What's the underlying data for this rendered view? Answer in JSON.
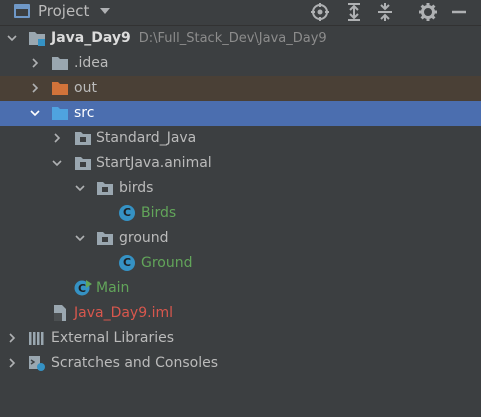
{
  "toolbar": {
    "title": "Project",
    "icons": [
      "project-panel-icon",
      "dropdown-icon",
      "locate-icon",
      "expand-all-icon",
      "collapse-all-icon",
      "settings-icon",
      "hide-icon"
    ]
  },
  "tree": {
    "root": {
      "name": "Java_Day9",
      "path": "D:\\Full_Stack_Dev\\Java_Day9"
    },
    "idea": ".idea",
    "out": "out",
    "src": "src",
    "standard": "Standard_Java",
    "animal": "StartJava.animal",
    "birds": "birds",
    "birds_class": "Birds",
    "ground": "ground",
    "ground_class": "Ground",
    "main": "Main",
    "iml": "Java_Day9.iml",
    "external": "External Libraries",
    "scratches": "Scratches and Consoles"
  },
  "colors": {
    "background": "#3c3f41",
    "selection": "#4b6eaf",
    "out_highlight": "#4a4036",
    "green_text": "#62a55a",
    "red_text": "#d8574d",
    "folder_blue": "#4fa3e0",
    "folder_orange": "#d1733a"
  }
}
